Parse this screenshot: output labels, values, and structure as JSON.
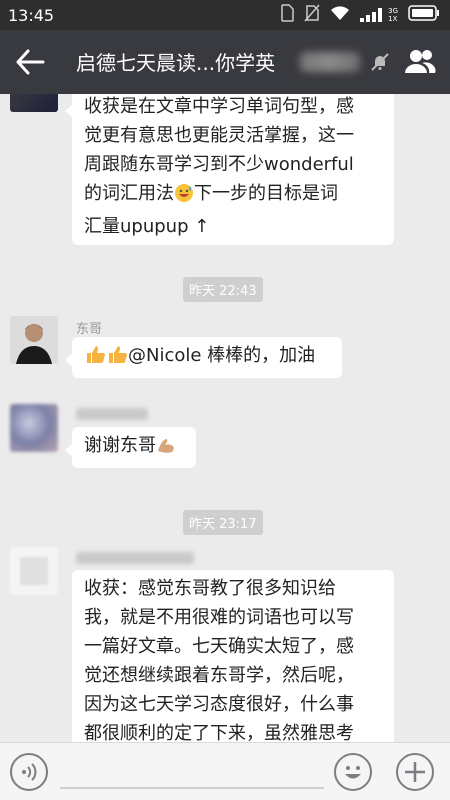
{
  "status_bar": {
    "time": "13:45",
    "network": "3G",
    "network_sub": "1X"
  },
  "header": {
    "title": "启德七天晨读...你学英",
    "back_icon": "back-arrow-icon",
    "mute_icon": "mute-bell-icon",
    "members_icon": "group-members-icon"
  },
  "messages": [
    {
      "type": "text",
      "sender": "",
      "text_lines": [
        "收获是在文章中学习单词句型，感",
        "觉更有意思也更能灵活掌握，这一",
        "周跟随东哥学习到不少wonderful",
        "的词汇用法"
      ],
      "line4_tail": "下一步的目标是词",
      "line5": "汇量upupup ↑"
    },
    {
      "type": "timestamp",
      "text": "昨天 22:43"
    },
    {
      "type": "text",
      "sender": "东哥",
      "text": "@Nicole 棒棒的，加油"
    },
    {
      "type": "text",
      "sender": "",
      "text": "谢谢东哥"
    },
    {
      "type": "timestamp",
      "text": "昨天 23:17"
    },
    {
      "type": "text",
      "sender": "",
      "text_lines": [
        "收获：感觉东哥教了很多知识给",
        "我，就是不用很难的词语也可以写",
        "一篇好文章。七天确实太短了，感",
        "觉还想继续跟着东哥学，然后呢，",
        "因为这七天学习态度很好，什么事",
        "都很顺利的定了下来，虽然雅思考"
      ]
    }
  ],
  "input_bar": {
    "voice_icon": "voice-icon",
    "emoji_icon": "emoji-icon",
    "plus_icon": "plus-icon"
  },
  "colors": {
    "header_bg": "#393a3f",
    "status_bg": "#2e2e2e",
    "chat_bg": "#ebebeb",
    "bubble_bg": "#ffffff",
    "timestamp_bg": "#cfcfcf"
  }
}
